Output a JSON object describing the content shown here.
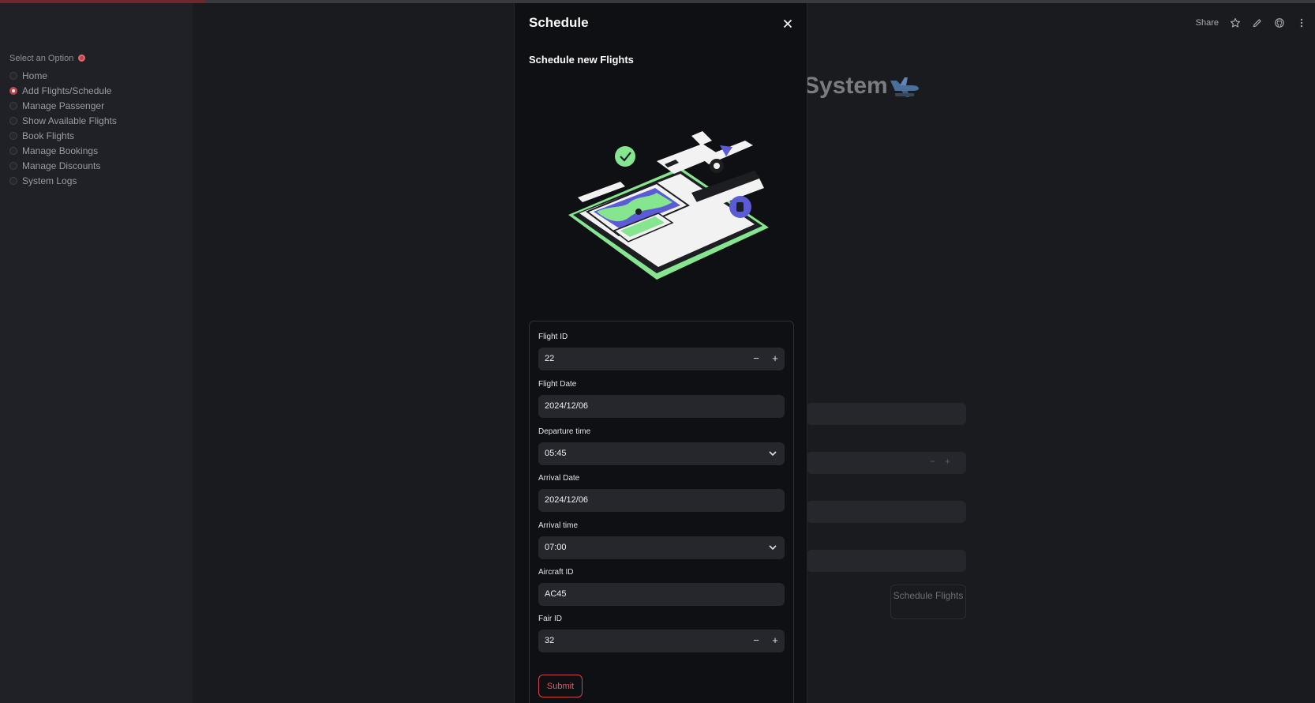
{
  "sidebar": {
    "label": "Select an Option",
    "options": [
      {
        "label": "Home",
        "selected": false
      },
      {
        "label": "Add Flights/Schedule",
        "selected": true
      },
      {
        "label": "Manage Passenger",
        "selected": false
      },
      {
        "label": "Show Available Flights",
        "selected": false
      },
      {
        "label": "Book Flights",
        "selected": false
      },
      {
        "label": "Manage Bookings",
        "selected": false
      },
      {
        "label": "Manage Discounts",
        "selected": false
      },
      {
        "label": "System Logs",
        "selected": false
      }
    ]
  },
  "toolbar": {
    "share_label": "Share",
    "icons": [
      "star-icon",
      "edit-icon",
      "github-icon",
      "more-icon"
    ]
  },
  "main": {
    "title_visible": "System",
    "button_label": "Schedule Flights"
  },
  "modal": {
    "title": "Schedule",
    "subtitle": "Schedule new Flights",
    "fields": {
      "flight_id": {
        "label": "Flight ID",
        "value": "22"
      },
      "flight_date": {
        "label": "Flight Date",
        "value": "2024/12/06"
      },
      "departure_time": {
        "label": "Departure time",
        "value": "05:45"
      },
      "arrival_date": {
        "label": "Arrival Date",
        "value": "2024/12/06"
      },
      "arrival_time": {
        "label": "Arrival time",
        "value": "07:00"
      },
      "aircraft_id": {
        "label": "Aircraft ID",
        "value": "AC45"
      },
      "fair_id": {
        "label": "Fair ID",
        "value": "32"
      }
    },
    "stepper": {
      "minus": "−",
      "plus": "+"
    },
    "submit_label": "Submit"
  },
  "colors": {
    "accent": "#d0434b",
    "background": "#1a1b1f",
    "modal_background": "#0f1014",
    "field_background": "#26272d",
    "illustration_green": "#86e68f",
    "illustration_purple": "#5b5bd6"
  }
}
